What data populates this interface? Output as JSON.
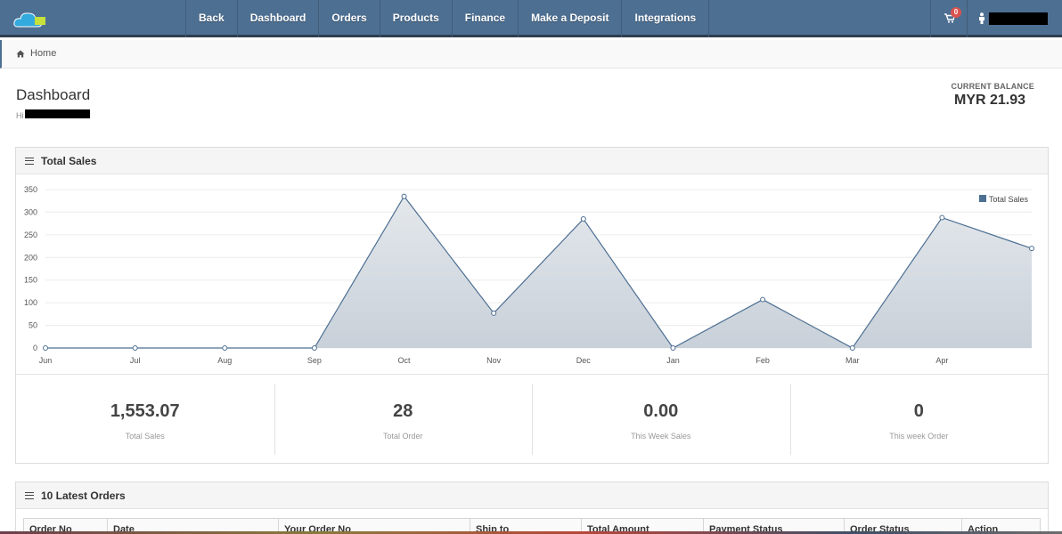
{
  "brand": {
    "logo_color": "#33aadd",
    "logo_accent": "#c7e03a"
  },
  "nav": {
    "items": [
      {
        "label": "Back",
        "name": "nav-back"
      },
      {
        "label": "Dashboard",
        "name": "nav-dashboard"
      },
      {
        "label": "Orders",
        "name": "nav-orders"
      },
      {
        "label": "Products",
        "name": "nav-products"
      },
      {
        "label": "Finance",
        "name": "nav-finance"
      },
      {
        "label": "Make a Deposit",
        "name": "nav-make-a-deposit"
      },
      {
        "label": "Integrations",
        "name": "nav-integrations"
      }
    ],
    "cart_icon": "shopping-cart-icon",
    "cart_count": "0",
    "user_icon": "user-icon"
  },
  "breadcrumb": {
    "icon": "home-icon",
    "label": "Home"
  },
  "header": {
    "title": "Dashboard",
    "greeting": "Hi",
    "balance_label": "CURRENT BALANCE",
    "balance_value": "MYR 21.93"
  },
  "sales_panel": {
    "title": "Total Sales"
  },
  "chart_data": {
    "type": "area",
    "title": "",
    "xlabel": "",
    "ylabel": "",
    "categories": [
      "Jun",
      "Jul",
      "Aug",
      "Sep",
      "Oct",
      "Nov",
      "Dec",
      "Jan",
      "Feb",
      "Mar",
      "Apr",
      ""
    ],
    "series": [
      {
        "name": "Total Sales",
        "color": "#4d6f92",
        "fill": "#c8d0d9",
        "values": [
          0,
          0,
          0,
          0,
          335,
          77,
          285,
          0,
          107,
          0,
          288,
          220
        ]
      }
    ],
    "ylim": [
      0,
      350
    ],
    "yticks": [
      0,
      50,
      100,
      150,
      200,
      250,
      300,
      350
    ],
    "grid": true,
    "legend": "top-right"
  },
  "stats": [
    {
      "value": "1,553.07",
      "label": "Total Sales"
    },
    {
      "value": "28",
      "label": "Total Order"
    },
    {
      "value": "0.00",
      "label": "This Week Sales"
    },
    {
      "value": "0",
      "label": "This week Order"
    }
  ],
  "orders_panel": {
    "title": "10 Latest Orders",
    "columns": [
      "Order No",
      "Date",
      "Your Order No",
      "Ship to",
      "Total Amount",
      "Payment Status",
      "Order Status",
      "Action"
    ]
  }
}
